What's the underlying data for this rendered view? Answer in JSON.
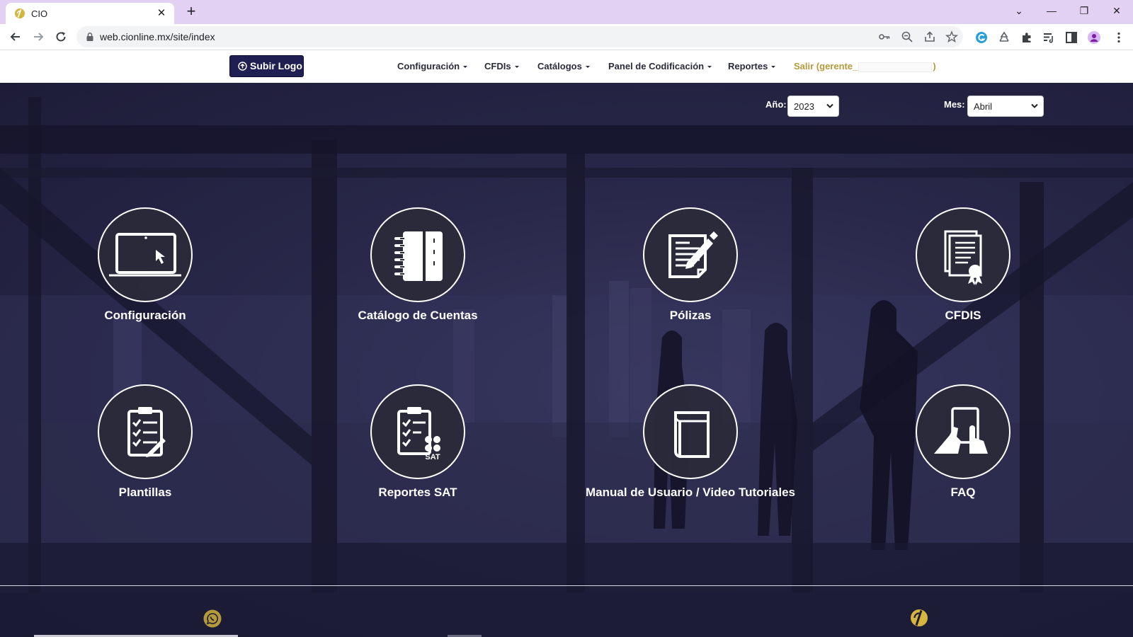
{
  "browser": {
    "tab_title": "CIO",
    "url": "web.cionline.mx/site/index",
    "tab_close": "✕",
    "new_tab": "+",
    "window_controls": [
      "⌄",
      "—",
      "❐",
      "✕"
    ]
  },
  "header": {
    "logo_button": "Subir Logo",
    "menu": [
      {
        "label": "Configuración"
      },
      {
        "label": "CFDIs"
      },
      {
        "label": "Catálogos"
      },
      {
        "label": "Panel de Codificación"
      },
      {
        "label": "Reportes"
      }
    ],
    "logout_prefix": "Salir (gerente_",
    "logout_suffix": ")"
  },
  "filters": {
    "year_label": "Año:",
    "year_value": "2023",
    "month_label": "Mes:",
    "month_value": "Abril"
  },
  "tiles": [
    {
      "label": "Configuración",
      "icon": "laptop-icon"
    },
    {
      "label": "Catálogo de Cuentas",
      "icon": "notebook-icon"
    },
    {
      "label": "Pólizas",
      "icon": "document-edit-icon"
    },
    {
      "label": "CFDIS",
      "icon": "certificate-icon"
    },
    {
      "label": "Plantillas",
      "icon": "clipboard-checklist-icon"
    },
    {
      "label": "Reportes SAT",
      "icon": "sat-report-icon"
    },
    {
      "label": "Manual de Usuario / Video Tutoriales",
      "icon": "book-icon"
    },
    {
      "label": "FAQ",
      "icon": "touch-tablet-icon"
    }
  ],
  "sat_badge": "SAT",
  "colors": {
    "navy": "#1f1f52",
    "gold": "#b59a3c",
    "tabbar": "#e3d1f3",
    "hero_overlay": "#2a2a4a"
  }
}
